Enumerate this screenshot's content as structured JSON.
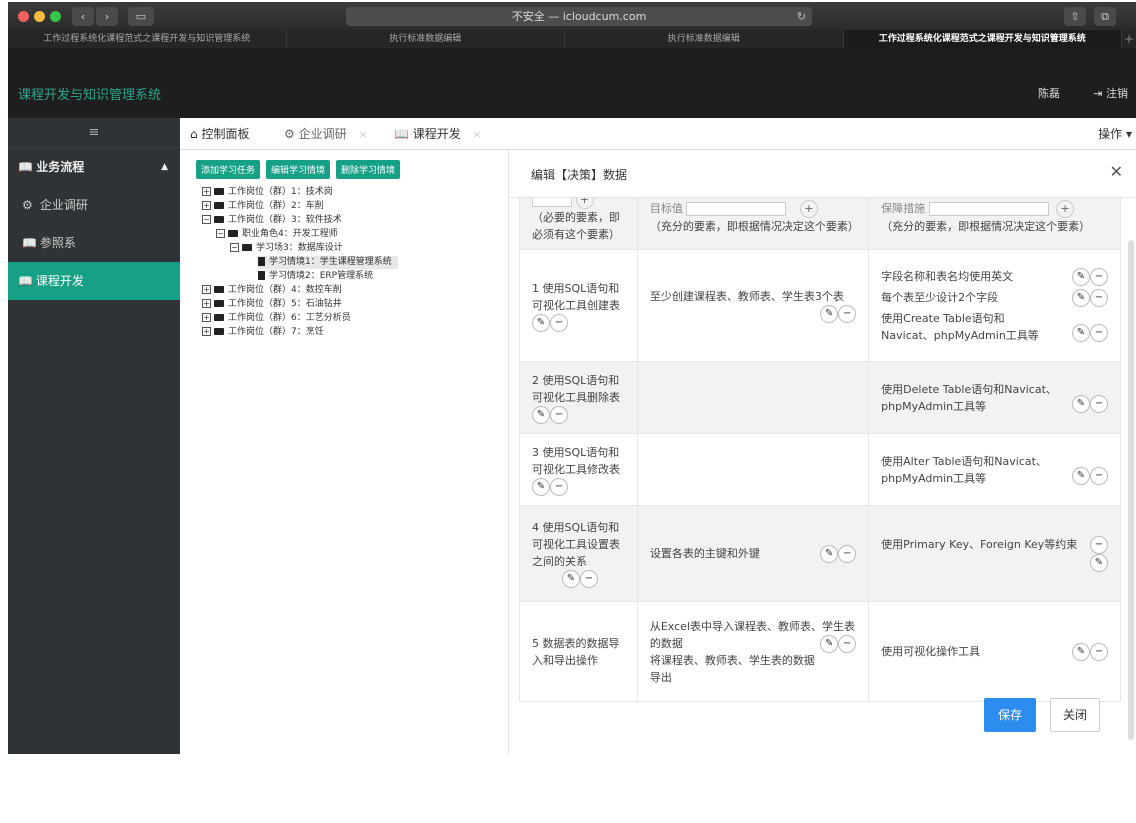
{
  "browser": {
    "address": "不安全 — icloudcum.com",
    "tabs": [
      "工作过程系统化课程范式之课程开发与知识管理系统",
      "执行标准数据编辑",
      "执行标准数据编辑",
      "工作过程系统化课程范式之课程开发与知识管理系统"
    ]
  },
  "header": {
    "title": "课程开发与知识管理系统",
    "user": "陈磊",
    "logout": "注销"
  },
  "sidebar": {
    "toggle": "≡",
    "section": "业务流程",
    "items": [
      {
        "label": "企业调研"
      },
      {
        "label": "参照系"
      },
      {
        "label": "课程开发"
      }
    ]
  },
  "content_tabs": [
    {
      "label": "控制面板"
    },
    {
      "label": "企业调研"
    },
    {
      "label": "课程开发"
    }
  ],
  "ops": "操作",
  "tree": {
    "buttons": [
      "添加学习任务",
      "编辑学习情境",
      "删除学习情境"
    ],
    "nodes": [
      "工作岗位（群）1：技术岗",
      "工作岗位（群）2：车削",
      "工作岗位（群）3：软件技术",
      "职业角色4：开发工程师",
      "学习场3：数据库设计",
      "学习情境1：学生课程管理系统",
      "学习情境2：ERP管理系统",
      "工作岗位（群）4：数控车削",
      "工作岗位（群）5：石油钻井",
      "工作岗位（群）6：工艺分析员",
      "工作岗位（群）7：烹饪"
    ]
  },
  "modal": {
    "title": "编辑【决策】数据",
    "header_labels": [
      "目标值",
      "保障措施"
    ],
    "header_notes": [
      "（必要的要素，即必须有这个要素）",
      "（充分的要素，即根据情况决定这个要素）",
      "（充分的要素，即根据情况决定这个要素）"
    ],
    "rows": [
      {
        "step": "1  使用SQL语句和可视化工具创建表",
        "target": "至少创建课程表、教师表、学生表3个表",
        "measures": [
          "字段名称和表名均使用英文",
          "每个表至少设计2个字段",
          "使用Create Table语句和Navicat、phpMyAdmin工具等"
        ]
      },
      {
        "step": "2  使用SQL语句和可视化工具删除表",
        "target": "",
        "measures": [
          "使用Delete Table语句和Navicat、phpMyAdmin工具等"
        ]
      },
      {
        "step": "3  使用SQL语句和可视化工具修改表",
        "target": "",
        "measures": [
          "使用Alter Table语句和Navicat、phpMyAdmin工具等"
        ]
      },
      {
        "step": "4  使用SQL语句和可视化工具设置表之间的关系",
        "target": "设置各表的主键和外键",
        "measures": [
          "使用Primary Key、Foreign Key等约束"
        ]
      },
      {
        "step": "5  数据表的数据导入和导出操作",
        "target": "从Excel表中导入课程表、教师表、学生表的数据",
        "target2": "将课程表、教师表、学生表的数据导出",
        "measures": [
          "使用可视化操作工具"
        ]
      }
    ],
    "save": "保存",
    "close": "关闭"
  },
  "colors": {
    "accent": "#16a085",
    "primary_btn": "#2d8cf0",
    "sidebar_bg": "#2f3336"
  }
}
